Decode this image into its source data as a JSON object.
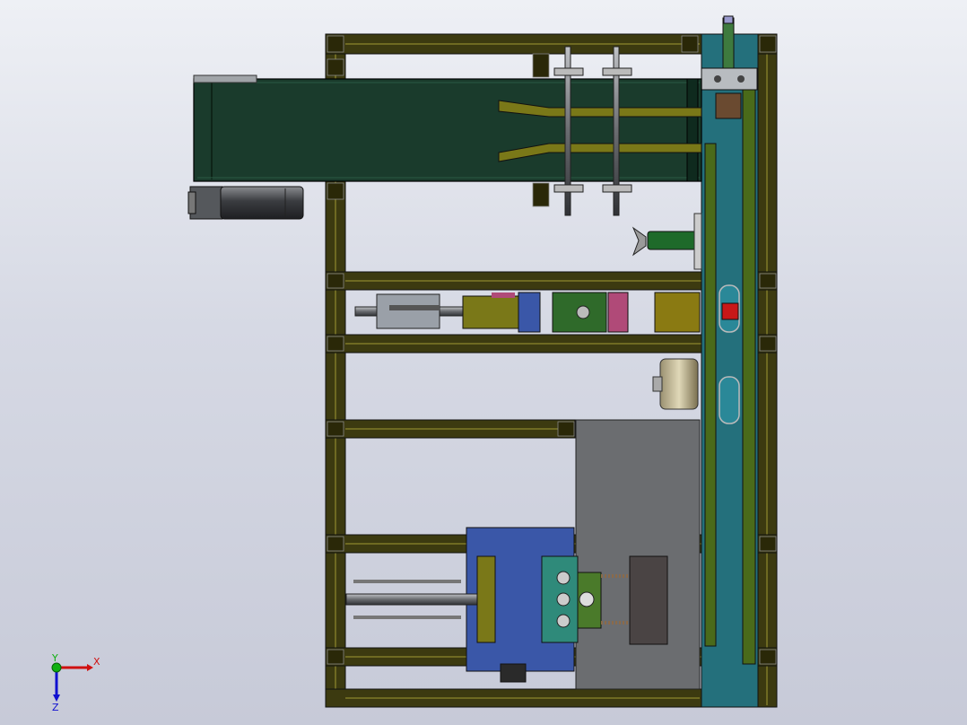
{
  "viewport": {
    "background_top": "#eef0f5",
    "background_bottom": "#c7cad8"
  },
  "model": {
    "colors": {
      "frame_profile": "#3c3a10",
      "frame_profile_light": "#6e6a22",
      "conveyor_belt": "#1a3b2c",
      "rail_blue": "#24707c",
      "rail_green": "#4a6a1a",
      "plate_grey": "#6b6d70",
      "motor_grey": "#3e4044",
      "accent_red": "#c81818",
      "accent_olive": "#8a7a12",
      "guide_yellow": "#7a7818",
      "block_teal": "#2f8a7a",
      "block_blue": "#3a57a8",
      "block_magenta": "#b04a78",
      "block_green": "#2f6a2a"
    }
  },
  "triad": {
    "x_label": "X",
    "y_label": "Y",
    "z_label": "Z",
    "x_color": "#d01010",
    "y_color": "#10b010",
    "z_color": "#1010d0"
  }
}
